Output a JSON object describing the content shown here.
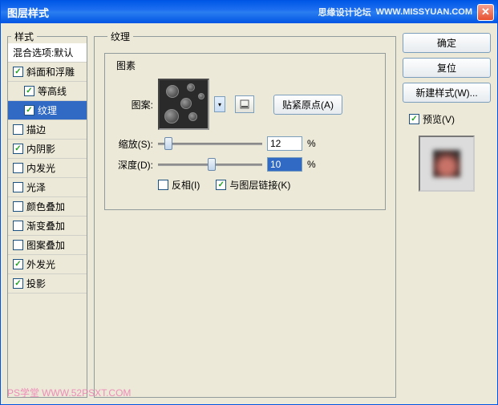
{
  "window": {
    "title": "图层样式",
    "tag1": "思缘设计论坛",
    "tag2": "WWW.MISSYUAN.COM"
  },
  "sidebar": {
    "legend": "样式",
    "header": "混合选项:默认",
    "items": [
      {
        "label": "斜面和浮雕",
        "on": true,
        "sel": false,
        "indent": 0
      },
      {
        "label": "等高线",
        "on": true,
        "sel": false,
        "indent": 1
      },
      {
        "label": "纹理",
        "on": true,
        "sel": true,
        "indent": 1
      },
      {
        "label": "描边",
        "on": false,
        "sel": false,
        "indent": 0
      },
      {
        "label": "内阴影",
        "on": true,
        "sel": false,
        "indent": 0
      },
      {
        "label": "内发光",
        "on": false,
        "sel": false,
        "indent": 0
      },
      {
        "label": "光泽",
        "on": false,
        "sel": false,
        "indent": 0
      },
      {
        "label": "颜色叠加",
        "on": false,
        "sel": false,
        "indent": 0
      },
      {
        "label": "渐变叠加",
        "on": false,
        "sel": false,
        "indent": 0
      },
      {
        "label": "图案叠加",
        "on": false,
        "sel": false,
        "indent": 0
      },
      {
        "label": "外发光",
        "on": true,
        "sel": false,
        "indent": 0
      },
      {
        "label": "投影",
        "on": true,
        "sel": false,
        "indent": 0
      }
    ]
  },
  "main": {
    "legend": "纹理",
    "group": "图素",
    "pattern_label": "图案:",
    "snap_button": "贴紧原点(A)",
    "scale_label": "缩放(S):",
    "scale_value": "12",
    "scale_unit": "%",
    "depth_label": "深度(D):",
    "depth_value": "10",
    "depth_unit": "%",
    "invert": "反相(I)",
    "link": "与图层链接(K)"
  },
  "right": {
    "ok": "确定",
    "reset": "复位",
    "newstyle": "新建样式(W)...",
    "preview": "预览(V)"
  },
  "watermark": {
    "a": "PS学堂",
    "b": "WWW.52PSXT.COM"
  }
}
